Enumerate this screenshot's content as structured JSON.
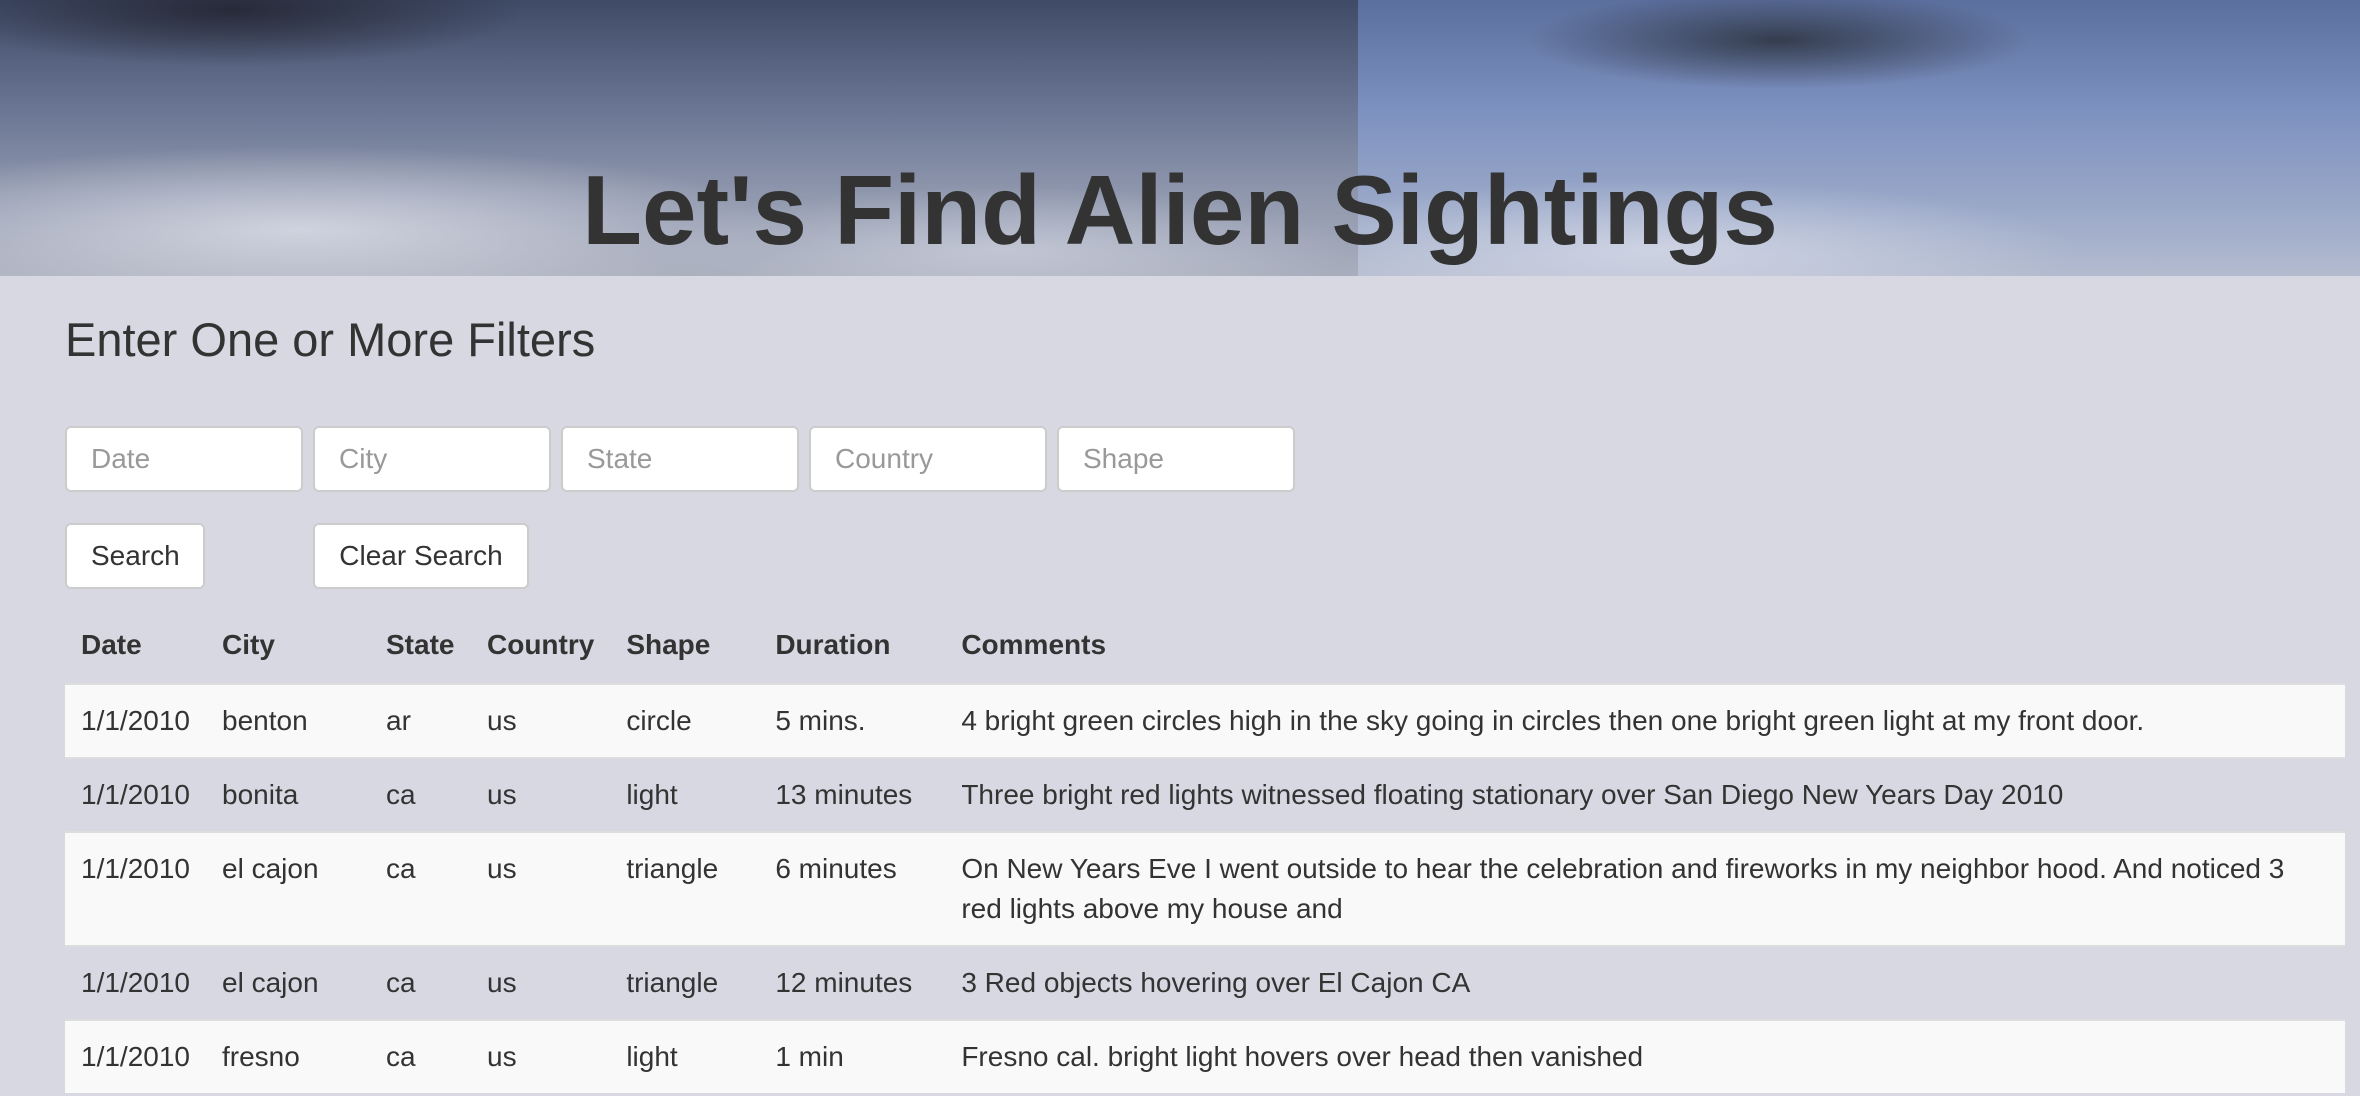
{
  "header": {
    "title": "Let's Find Alien Sightings"
  },
  "filters": {
    "heading": "Enter One or More Filters",
    "date_placeholder": "Date",
    "city_placeholder": "City",
    "state_placeholder": "State",
    "country_placeholder": "Country",
    "shape_placeholder": "Shape",
    "search_label": "Search",
    "clear_label": "Clear Search"
  },
  "table": {
    "columns": [
      "Date",
      "City",
      "State",
      "Country",
      "Shape",
      "Duration",
      "Comments"
    ],
    "rows": [
      [
        "1/1/2010",
        "benton",
        "ar",
        "us",
        "circle",
        "5 mins.",
        "4 bright green circles high in the sky going in circles then one bright green light at my front door."
      ],
      [
        "1/1/2010",
        "bonita",
        "ca",
        "us",
        "light",
        "13 minutes",
        "Three bright red lights witnessed floating stationary over San Diego New Years Day 2010"
      ],
      [
        "1/1/2010",
        "el cajon",
        "ca",
        "us",
        "triangle",
        "6 minutes",
        "On New Years Eve I went outside to hear the celebration and fireworks in my neighbor hood. And noticed 3 red lights above my house and"
      ],
      [
        "1/1/2010",
        "el cajon",
        "ca",
        "us",
        "triangle",
        "12 minutes",
        "3 Red objects hovering over El Cajon CA"
      ],
      [
        "1/1/2010",
        "fresno",
        "ca",
        "us",
        "light",
        "1 min",
        "Fresno cal. bright light hovers over head then vanished"
      ]
    ]
  }
}
